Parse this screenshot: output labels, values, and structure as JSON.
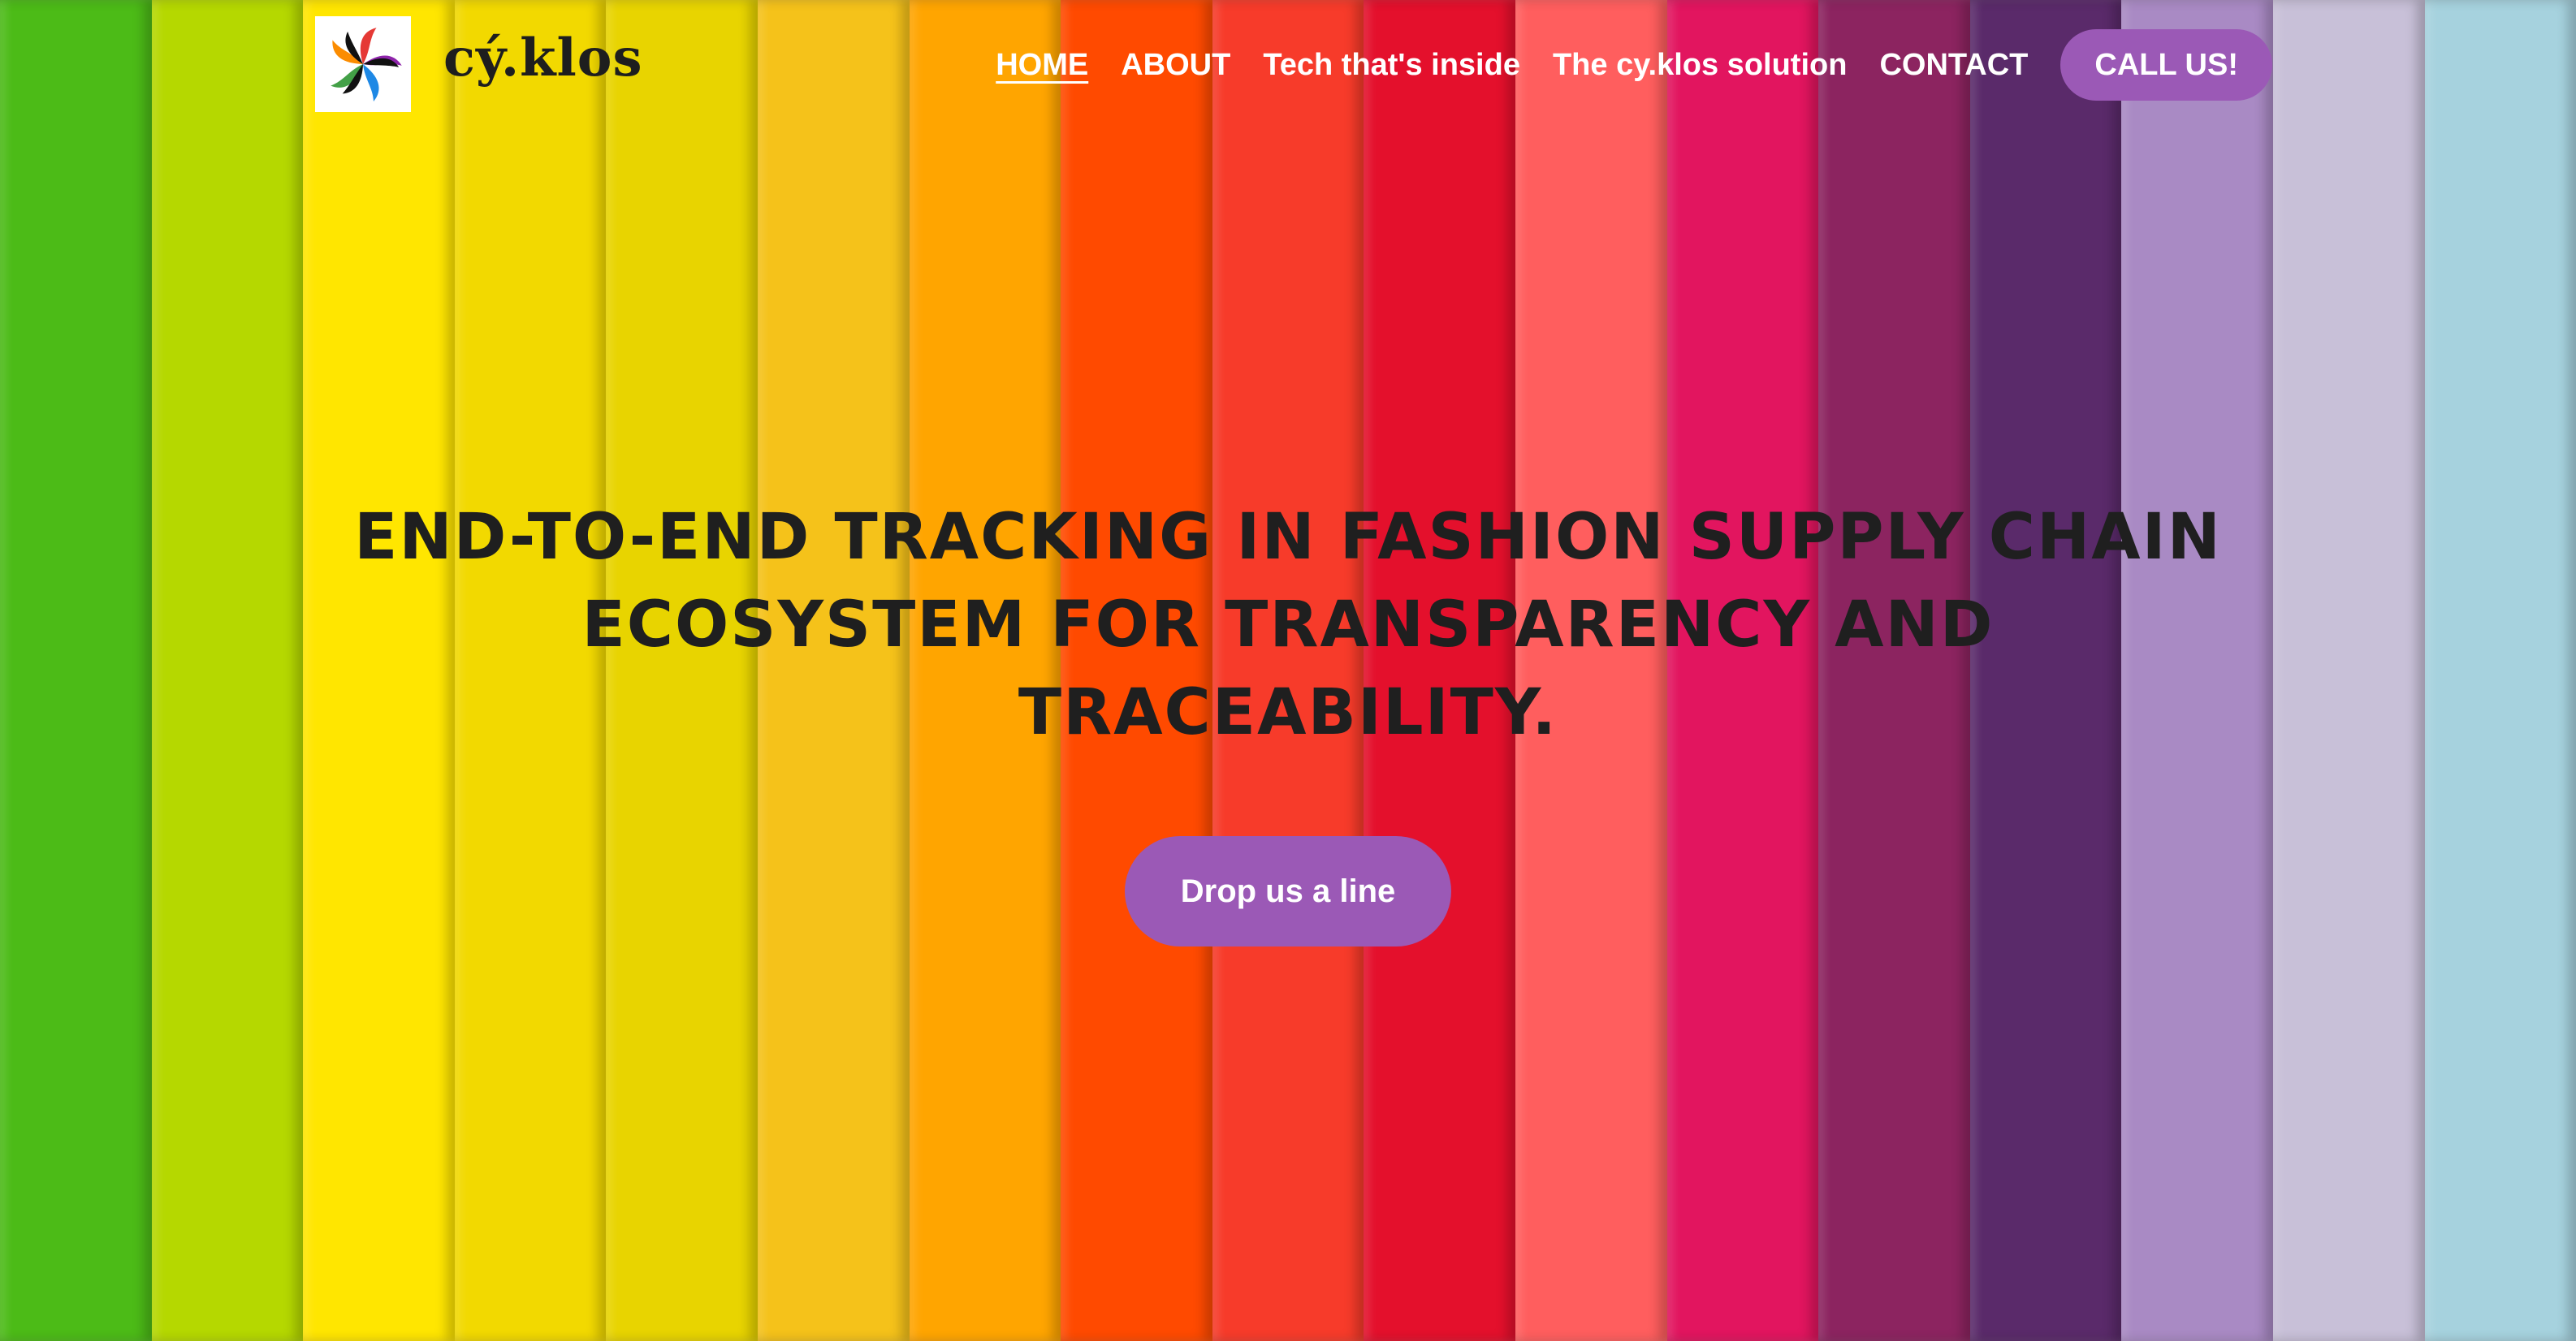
{
  "brand": {
    "name": "cý.klos",
    "logo_icon": "pinwheel-logo-icon"
  },
  "nav": {
    "items": [
      {
        "label": "HOME",
        "active": true
      },
      {
        "label": "ABOUT",
        "active": false
      },
      {
        "label": "Tech that's inside",
        "active": false
      },
      {
        "label": "The cy.klos solution",
        "active": false
      },
      {
        "label": "CONTACT",
        "active": false
      }
    ],
    "call_button": "CALL US!"
  },
  "hero": {
    "title": "END-TO-END TRACKING IN FASHION SUPPLY CHAIN ECOSYSTEM FOR TRANSPARENCY AND TRACEABILITY.",
    "cta_label": "Drop us a line"
  },
  "colors": {
    "accent": "#9b59b6",
    "nav_text": "#ffffff",
    "title_text": "#1f1f1f",
    "stripes": [
      "#4cbb17",
      "#b5d800",
      "#ffe600",
      "#f2d900",
      "#e8d400",
      "#f5c21a",
      "#ffa500",
      "#ff4a00",
      "#f73b2a",
      "#e4102c",
      "#ff5e5e",
      "#e2155f",
      "#8c2460",
      "#5a2a6a",
      "#a98ac4",
      "#c8c0d8",
      "#a6d2de"
    ]
  }
}
